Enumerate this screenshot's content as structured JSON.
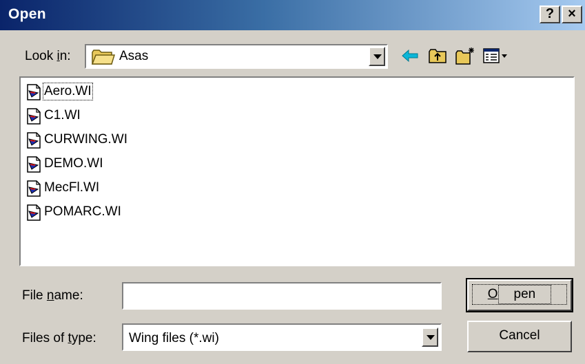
{
  "window": {
    "title": "Open",
    "help_label": "?",
    "close_label": "×"
  },
  "lookin": {
    "label_pre": "Look ",
    "label_key": "i",
    "label_post": "n:",
    "value": "Asas",
    "icon": "folder-icon"
  },
  "toolbar": [
    {
      "name": "back-icon"
    },
    {
      "name": "up-folder-icon"
    },
    {
      "name": "new-folder-icon"
    },
    {
      "name": "view-menu-icon"
    }
  ],
  "files": [
    {
      "name": "Aero.WI",
      "icon": "wing-document-icon",
      "focused": true
    },
    {
      "name": "C1.WI",
      "icon": "wing-document-icon",
      "focused": false
    },
    {
      "name": "CURWING.WI",
      "icon": "wing-document-icon",
      "focused": false
    },
    {
      "name": "DEMO.WI",
      "icon": "wing-document-icon",
      "focused": false
    },
    {
      "name": "MecFl.WI",
      "icon": "wing-document-icon",
      "focused": false
    },
    {
      "name": "POMARC.WI",
      "icon": "wing-document-icon",
      "focused": false
    }
  ],
  "filename": {
    "label_pre": "File ",
    "label_key": "n",
    "label_post": "ame:",
    "value": "",
    "placeholder": ""
  },
  "filetype": {
    "label_pre": "Files of ",
    "label_key": "t",
    "label_post": "ype:",
    "value": "Wing files (*.wi)"
  },
  "buttons": {
    "open_key": "O",
    "open_rest": "pen",
    "cancel": "Cancel"
  },
  "colors": {
    "title_start": "#0a246a",
    "title_end": "#a6caf0",
    "face": "#d4d0c8"
  }
}
